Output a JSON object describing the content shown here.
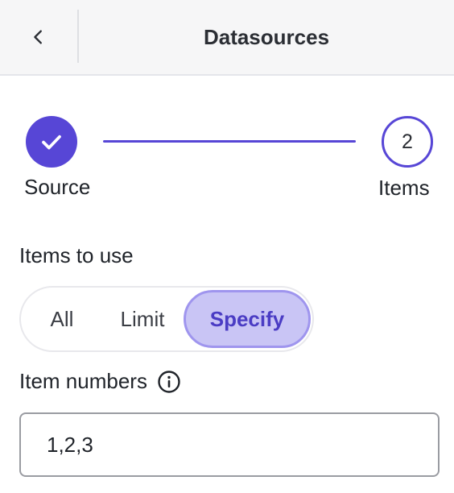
{
  "header": {
    "title": "Datasources",
    "back_icon": "chevron-left-icon"
  },
  "stepper": {
    "steps": [
      {
        "label": "Source",
        "state": "completed",
        "icon": "check-icon"
      },
      {
        "label": "Items",
        "number": "2",
        "state": "active"
      }
    ]
  },
  "items_to_use": {
    "label": "Items to use",
    "options": [
      "All",
      "Limit",
      "Specify"
    ],
    "selected": "Specify"
  },
  "item_numbers": {
    "label": "Item numbers",
    "info_icon": "info-icon",
    "value": "1,2,3"
  },
  "colors": {
    "accent": "#5746d6",
    "selected_bg": "#c9c5f5",
    "selected_border": "#9f95ee",
    "selected_text": "#4a3cc4"
  }
}
